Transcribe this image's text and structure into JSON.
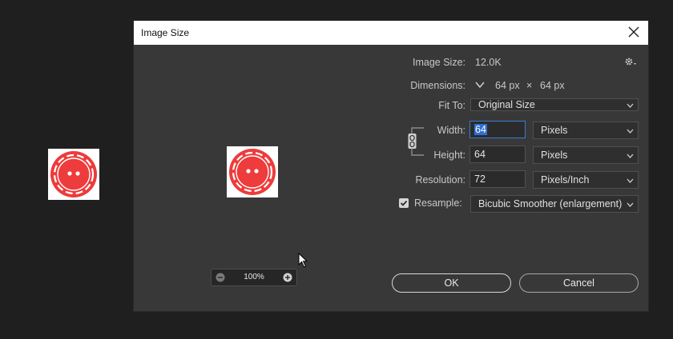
{
  "dialog": {
    "title": "Image Size",
    "zoom": "100%"
  },
  "info": {
    "image_size_label": "Image Size:",
    "image_size_value": "12.0K",
    "dimensions_label": "Dimensions:",
    "dim_width": "64 px",
    "dim_times": "×",
    "dim_height": "64 px",
    "fit_to_label": "Fit To:",
    "fit_to_value": "Original Size"
  },
  "fields": {
    "width_label": "Width:",
    "width_value": "64",
    "width_unit": "Pixels",
    "height_label": "Height:",
    "height_value": "64",
    "height_unit": "Pixels",
    "resolution_label": "Resolution:",
    "resolution_value": "72",
    "resolution_unit": "Pixels/Inch",
    "resample_label": "Resample:",
    "resample_checked": true,
    "resample_value": "Bicubic Smoother (enlargement)"
  },
  "buttons": {
    "ok": "OK",
    "cancel": "Cancel"
  },
  "icons": {
    "button_image": "sewing-button-icon",
    "settings": "gear-icon",
    "close": "close-icon",
    "link": "chain-link-icon"
  },
  "colors": {
    "button_red": "#ee3b3b",
    "dialog_bg": "#383838",
    "app_bg": "#1f1f1f",
    "focus_blue": "#3b7bd4"
  }
}
